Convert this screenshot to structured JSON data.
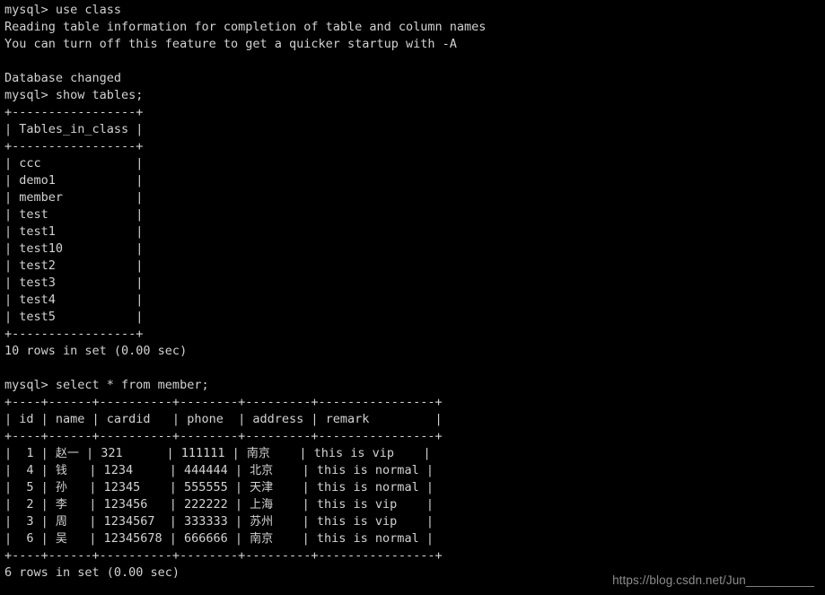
{
  "terminal": {
    "prompt": "mysql> ",
    "background_color": "#000000",
    "text_color": "#d2d2d2",
    "commands": {
      "use_class": "use class",
      "show_tables": "show tables;",
      "select_member": "select * from member;"
    },
    "messages": {
      "reading_table_info": "Reading table information for completion of table and column names",
      "turn_off_feature": "You can turn off this feature to get a quicker startup with -A",
      "database_changed": "Database changed",
      "tables_rows_in_set": "10 rows in set (0.00 sec)",
      "member_rows_in_set": "6 rows in set (0.00 sec)"
    },
    "tables_result": {
      "header": "Tables_in_class",
      "rows": [
        "ccc",
        "demo1",
        "member",
        "test",
        "test1",
        "test10",
        "test2",
        "test3",
        "test4",
        "test5"
      ],
      "row_count": 10,
      "border": "+-----------------+"
    },
    "member_result": {
      "columns": [
        "id",
        "name",
        "cardid",
        "phone",
        "address",
        "remark"
      ],
      "border": "+------+--------+----------+--------+---------+---------------+",
      "rows": [
        {
          "id": "1",
          "name": "赵一",
          "cardid": "321",
          "phone": "111111",
          "address": "南京",
          "remark": "this is vip"
        },
        {
          "id": "4",
          "name": "钱",
          "cardid": "1234",
          "phone": "444444",
          "address": "北京",
          "remark": "this is normal"
        },
        {
          "id": "5",
          "name": "孙",
          "cardid": "12345",
          "phone": "555555",
          "address": "天津",
          "remark": "this is normal"
        },
        {
          "id": "2",
          "name": "李",
          "cardid": "123456",
          "phone": "222222",
          "address": "上海",
          "remark": "this is vip"
        },
        {
          "id": "3",
          "name": "周",
          "cardid": "1234567",
          "phone": "333333",
          "address": "苏州",
          "remark": "this is vip"
        },
        {
          "id": "6",
          "name": "吴",
          "cardid": "12345678",
          "phone": "666666",
          "address": "南京",
          "remark": "this is normal"
        }
      ],
      "row_count": 6
    }
  },
  "watermark": {
    "text": "https://blog.csdn.net/Jun__________",
    "color": "#8c8c8c"
  }
}
